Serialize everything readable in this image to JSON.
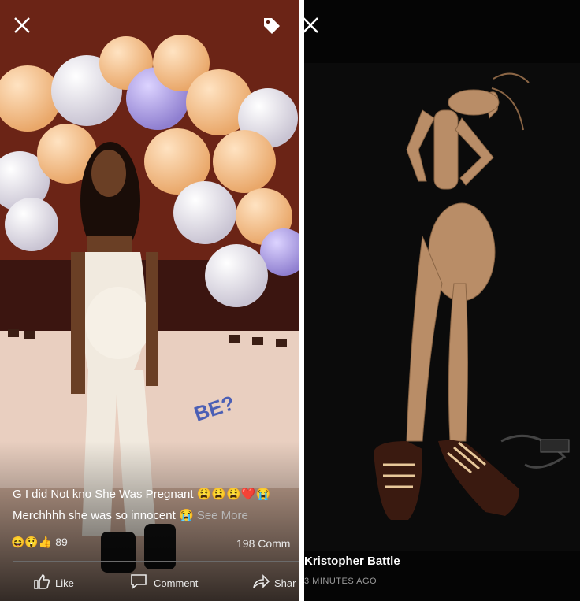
{
  "left_post": {
    "caption_line1": "G I did Not kno She Was Pregnant 😩😩😩❤️😭",
    "caption_line2": "Merchhhh she was so innocent 😭",
    "see_more": "See More",
    "reaction_emojis": "😆😲👍",
    "reaction_count": "89",
    "comments_count": "198 Comm",
    "actions": {
      "like": "Like",
      "comment": "Comment",
      "share": "Shar"
    },
    "decor_text": "BE?"
  },
  "right_post": {
    "author": "Kristopher Battle",
    "timestamp": "3 MINUTES AGO"
  },
  "colors": {
    "balloon_peach": "#f3b97d",
    "balloon_lilac": "#b7a9e6",
    "balloon_white": "#ece9ef",
    "tablecloth": "#e9cfc0",
    "backdrop": "#5a1e12"
  },
  "icons": [
    "close-icon",
    "tag-icon",
    "like-icon",
    "comment-icon",
    "share-icon"
  ]
}
